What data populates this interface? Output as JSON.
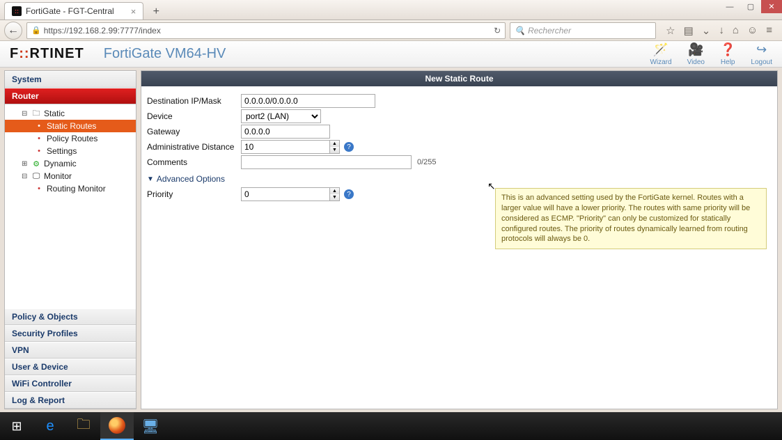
{
  "window": {
    "tab_title": "FortiGate - FGT-Central"
  },
  "browser": {
    "url": "https://192.168.2.99:7777/index",
    "search_placeholder": "Rechercher"
  },
  "header": {
    "logo_text": "FORTINET",
    "title": "FortiGate VM64-HV",
    "buttons": {
      "wizard": "Wizard",
      "video": "Video",
      "help": "Help",
      "logout": "Logout"
    }
  },
  "sidebar": {
    "sections": {
      "system": "System",
      "router": "Router",
      "policy": "Policy & Objects",
      "security": "Security Profiles",
      "vpn": "VPN",
      "user": "User & Device",
      "wifi": "WiFi Controller",
      "log": "Log & Report"
    },
    "tree": {
      "static": "Static",
      "static_routes": "Static Routes",
      "policy_routes": "Policy Routes",
      "settings": "Settings",
      "dynamic": "Dynamic",
      "monitor": "Monitor",
      "routing_monitor": "Routing Monitor"
    }
  },
  "main": {
    "title": "New Static Route",
    "labels": {
      "dest": "Destination IP/Mask",
      "device": "Device",
      "gateway": "Gateway",
      "admin_dist": "Administrative Distance",
      "comments": "Comments",
      "adv": "Advanced Options",
      "priority": "Priority"
    },
    "values": {
      "dest": "0.0.0.0/0.0.0.0",
      "device_selected": "port2 (LAN)",
      "gateway": "0.0.0.0",
      "admin_dist": "10",
      "comments": "",
      "comments_count": "0/255",
      "priority": "0"
    },
    "tooltip": "This is an advanced setting used by the FortiGate kernel. Routes with a larger value will have a lower priority. The routes with same priority will be considered as ECMP. \"Priority\" can only be customized for statically configured routes. The priority of routes dynamically learned from routing protocols will always be 0."
  }
}
